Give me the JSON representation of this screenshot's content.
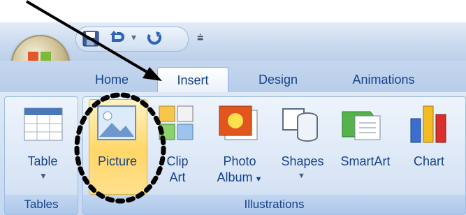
{
  "tabs": [
    {
      "label": "Home"
    },
    {
      "label": "Insert",
      "active": true
    },
    {
      "label": "Design"
    },
    {
      "label": "Animations"
    }
  ],
  "groups": {
    "tables": {
      "label": "Tables",
      "buttons": [
        {
          "label": "Table"
        }
      ]
    },
    "illustrations": {
      "label": "Illustrations",
      "buttons": [
        {
          "line1": "Picture",
          "line2": ""
        },
        {
          "line1": "Clip",
          "line2": "Art"
        },
        {
          "line1": "Photo",
          "line2": "Album"
        },
        {
          "line1": "Shapes",
          "line2": ""
        },
        {
          "line1": "SmartArt",
          "line2": ""
        },
        {
          "line1": "Chart",
          "line2": ""
        }
      ]
    }
  },
  "icons": {
    "office": "office-button-icon",
    "save": "save-icon",
    "undo": "undo-icon",
    "redo": "redo-icon",
    "customize": "customize-qat-icon"
  },
  "colors": {
    "ribbon_text": "#15428b",
    "highlight": "#ffd768"
  }
}
